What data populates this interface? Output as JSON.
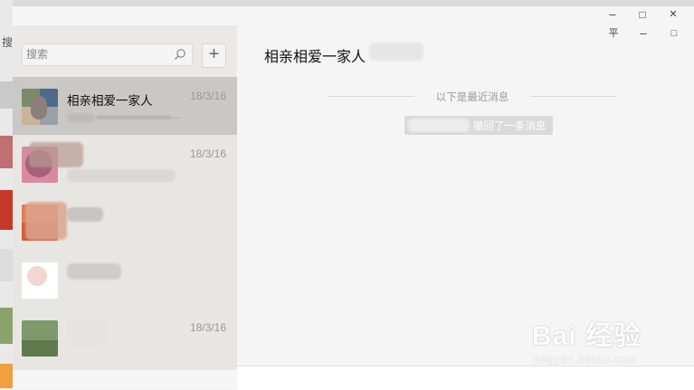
{
  "window": {
    "title": "相亲相爱一家人",
    "controls": {
      "pin": "平",
      "minimize": "–",
      "maximize": "□",
      "close": "✕"
    }
  },
  "background_app": {
    "search_stub": "搜"
  },
  "sidebar": {
    "search": {
      "placeholder": "搜索"
    },
    "add_label": "+",
    "chats": [
      {
        "name": "相亲相爱一家人",
        "date": "18/3/16",
        "preview": "",
        "active": true
      },
      {
        "name": "",
        "date": "18/3/16",
        "preview": "",
        "active": false
      },
      {
        "name": "",
        "date": "",
        "preview": "",
        "active": false
      },
      {
        "name": "",
        "date": "",
        "preview": "",
        "active": false
      },
      {
        "name": "",
        "date": "18/3/16",
        "preview": "",
        "active": false
      }
    ]
  },
  "conversation": {
    "recent_divider": "以下是最近消息",
    "system_message": "撤回了一条消息"
  },
  "watermark": {
    "main": "Bai 经验",
    "sub": "jingyan.baidu.com"
  },
  "colors": {
    "sidebar": "#e8e6e3",
    "active_item": "#cac8c6",
    "main_bg": "#f5f5f5"
  }
}
